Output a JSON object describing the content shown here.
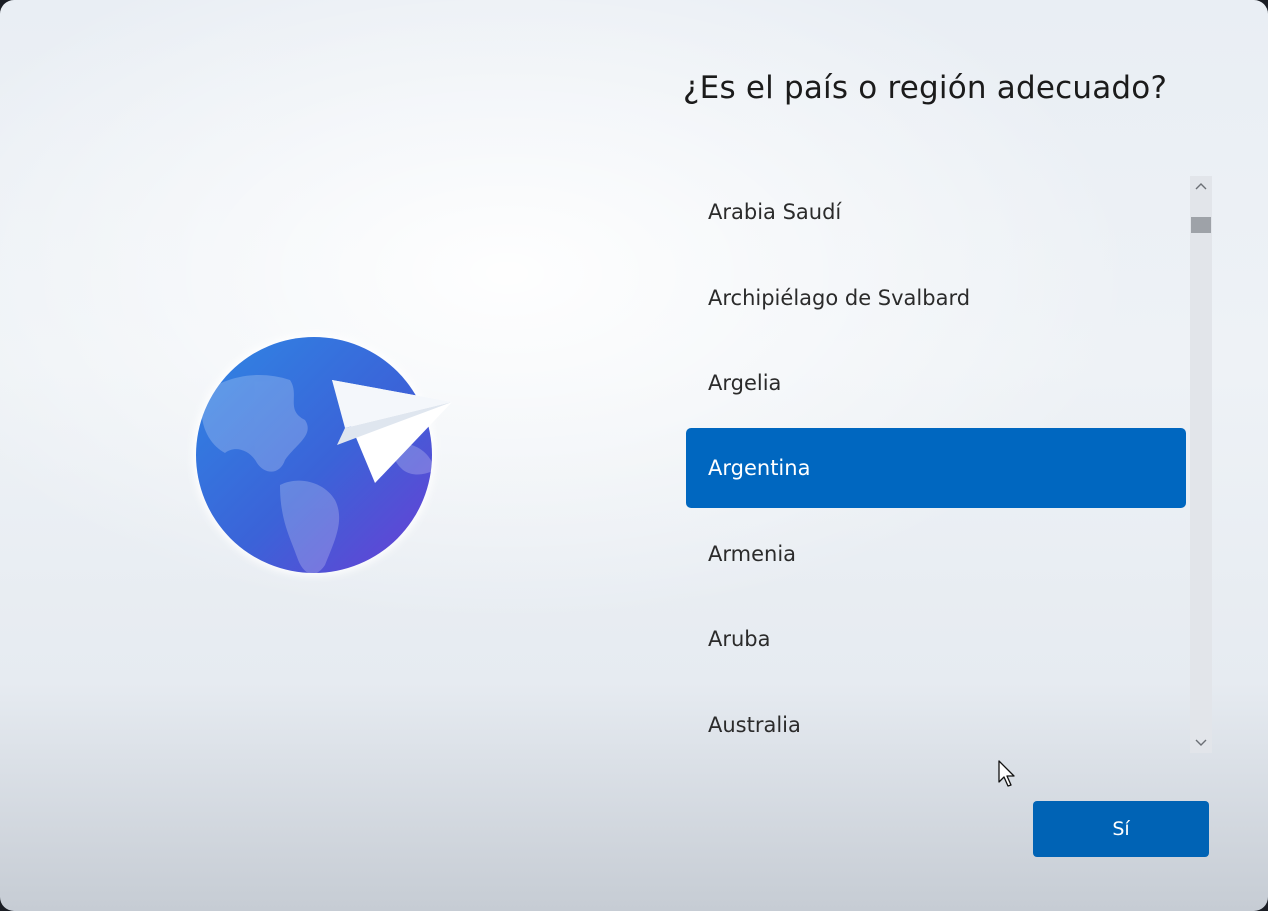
{
  "heading": "¿Es el país o región adecuado?",
  "regions": [
    {
      "label": "Arabia Saudí",
      "selected": false
    },
    {
      "label": "Archipiélago de Svalbard",
      "selected": false
    },
    {
      "label": "Argelia",
      "selected": false
    },
    {
      "label": "Argentina",
      "selected": true
    },
    {
      "label": "Armenia",
      "selected": false
    },
    {
      "label": "Aruba",
      "selected": false
    },
    {
      "label": "Australia",
      "selected": false
    }
  ],
  "confirm_button_label": "Sí",
  "colors": {
    "accent": "#0067c0",
    "button": "#0063b5",
    "globe_light": "#3f8ae6",
    "globe_dark": "#5a3fd6"
  },
  "icons": {
    "illustration": "globe-with-paper-plane",
    "scroll_up": "chevron-up-icon",
    "scroll_down": "chevron-down-icon",
    "cursor": "mouse-pointer-icon"
  }
}
